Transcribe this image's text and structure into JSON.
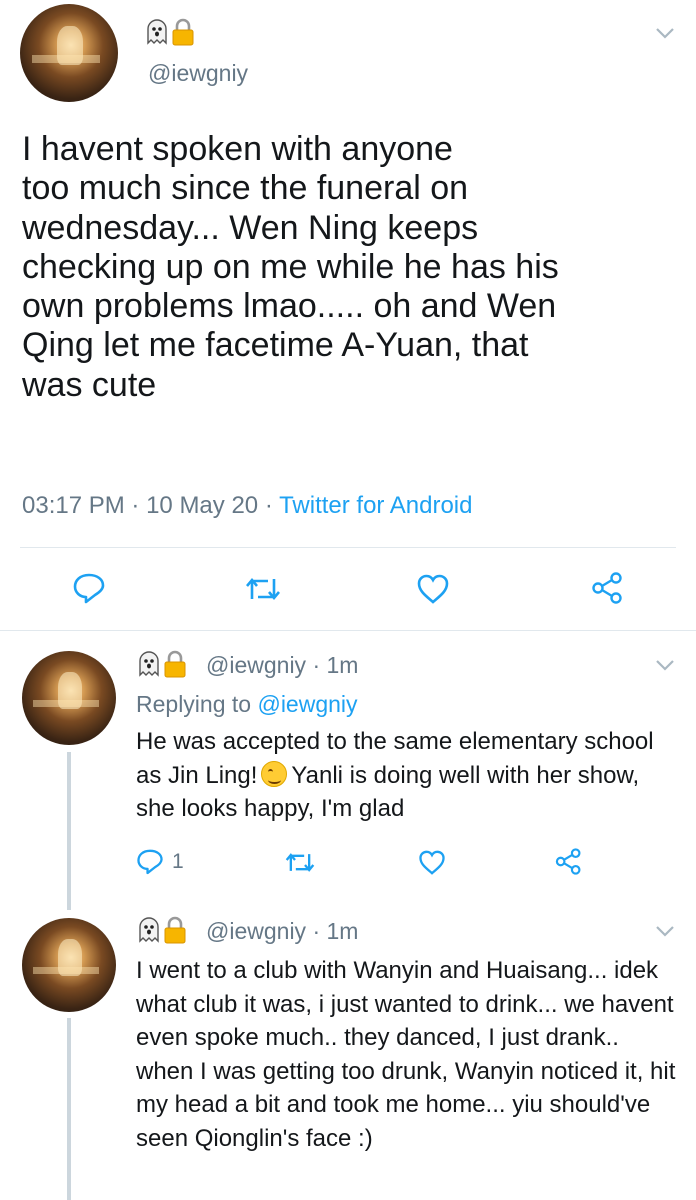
{
  "main_tweet": {
    "handle": "@iewgniy",
    "badges": [
      "ghost-emoji",
      "lock-emoji"
    ],
    "text": "I havent spoken with anyone\ntoo much since the funeral on\nwednesday... Wen Ning keeps\nchecking up on me while he has his\nown problems lmao..... oh and Wen\nQing let me facetime A-Yuan, that\nwas cute",
    "time": "03:17 PM",
    "separator": "·",
    "date": "10 May 20",
    "source": "Twitter for Android",
    "actions": [
      "reply-icon",
      "retweet-icon",
      "like-icon",
      "share-icon"
    ]
  },
  "replies": [
    {
      "handle": "@iewgniy",
      "time": "1m",
      "separator": "·",
      "replying_prefix": "Replying to",
      "replying_to": "@iewgniy",
      "text_before_emoji": "He was accepted to the same elementary school as Jin Ling!",
      "emoji": "smiling-face-emoji",
      "text_after_emoji": "Yanli is doing well with her show, she looks happy, I'm glad",
      "reply_count": "1"
    },
    {
      "handle": "@iewgniy",
      "time": "1m",
      "separator": "·",
      "text": "I went to a club with Wanyin and Huaisang... idek what club it was, i just wanted to drink... we havent even spoke much.. they danced, I just drank.. when I was getting too drunk, Wanyin noticed it, hit my head a bit and took me home... yiu should've seen Qionglin's face :)"
    }
  ],
  "colors": {
    "text": "#14171a",
    "secondary": "#657786",
    "accent": "#1da1f2",
    "divider": "#e1e8ed",
    "thread_line": "#ccd6dd"
  }
}
